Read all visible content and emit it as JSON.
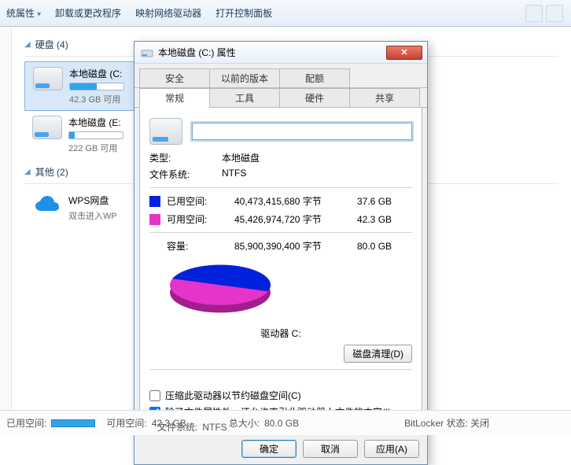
{
  "toolbar": {
    "items": [
      "统属性",
      "卸载或更改程序",
      "映射网络驱动器",
      "打开控制面板"
    ]
  },
  "sections": {
    "disks": {
      "title": "硬盘 (4)"
    },
    "other": {
      "title": "其他 (2)"
    }
  },
  "drives": [
    {
      "title": "本地磁盘 (C:",
      "sub": "42.3 GB 可用",
      "progress_pct": 50
    },
    {
      "title": "本地磁盘 (E:",
      "sub": "222 GB 可用",
      "progress_pct": 10
    }
  ],
  "cloud": {
    "title": "WPS网盘",
    "sub": "双击进入WP"
  },
  "dialog": {
    "title": "本地磁盘 (C:) 属性",
    "tabs_row1": [
      "安全",
      "以前的版本",
      "配额"
    ],
    "tabs_row2": [
      "常规",
      "工具",
      "硬件",
      "共享"
    ],
    "active_tab": "常规",
    "name_value": "",
    "kv": {
      "type_label": "类型:",
      "type_value": "本地磁盘",
      "fs_label": "文件系统:",
      "fs_value": "NTFS"
    },
    "usage": {
      "used_label": "已用空间:",
      "used_bytes": "40,473,415,680 字节",
      "used_hr": "37.6 GB",
      "used_color": "#0022dd",
      "free_label": "可用空间:",
      "free_bytes": "45,426,974,720 字节",
      "free_hr": "42.3 GB",
      "free_color": "#e633c9",
      "cap_label": "容量:",
      "cap_bytes": "85,900,390,400 字节",
      "cap_hr": "80.0 GB"
    },
    "drive_label": "驱动器 C:",
    "cleanup_btn": "磁盘清理(D)",
    "check_compress": "压缩此驱动器以节约磁盘空间(C)",
    "check_index": "除了文件属性外，还允许索引此驱动器上文件的内容(I)",
    "buttons": {
      "ok": "确定",
      "cancel": "取消",
      "apply": "应用(A)"
    }
  },
  "chart_data": {
    "type": "pie",
    "title": "驱动器 C:",
    "series": [
      {
        "name": "已用空间",
        "value": 37.6,
        "color": "#0022dd"
      },
      {
        "name": "可用空间",
        "value": 42.3,
        "color": "#e633c9"
      }
    ],
    "unit": "GB",
    "total": 80.0
  },
  "status": {
    "used_label": "已用空间:",
    "free_label": "可用空间:",
    "free_value": "42.3 GB",
    "size_label": "总大小:",
    "size_value": "80.0 GB",
    "fs_label": "文件系统:",
    "fs_value": "NTFS",
    "bitlocker": "BitLocker 状态: 关闭"
  }
}
